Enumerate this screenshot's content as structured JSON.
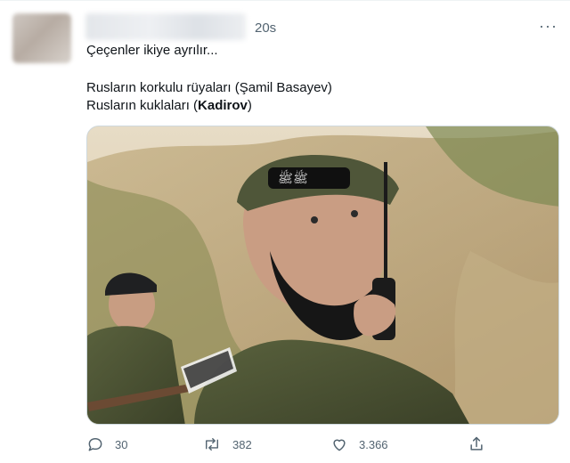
{
  "tweet": {
    "time": "20s",
    "more_label": "···",
    "lines": {
      "line1": "Çeçenler ikiye ayrılır...",
      "line2": "Rusların korkulu rüyaları (Şamil Basayev)",
      "line3_prefix": "Rusların kukla­ları (",
      "line3_bold": "Kadirov",
      "line3_suffix": ")"
    },
    "counts": {
      "replies": "30",
      "retweets": "382",
      "likes": "3.366"
    }
  },
  "icons": {
    "reply": "reply-icon",
    "retweet": "retweet-icon",
    "like": "heart-icon",
    "share": "share-icon"
  },
  "colors": {
    "text": "#0f1419",
    "muted": "#536471",
    "border": "#cfd9de"
  }
}
